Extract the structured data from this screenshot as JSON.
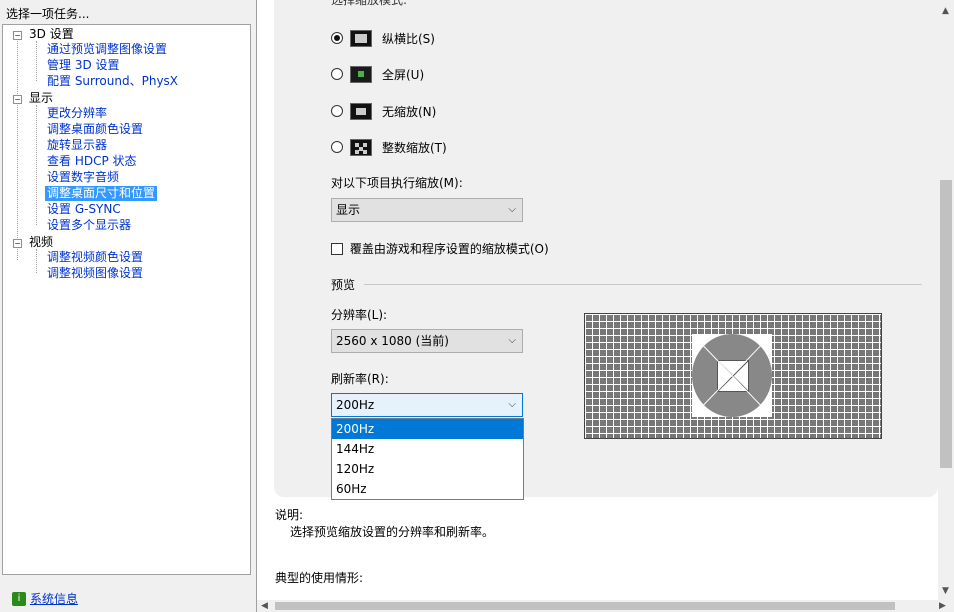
{
  "left_panel": {
    "header": "选择一项任务...",
    "tree": [
      {
        "label": "3D 设置",
        "kind": "category"
      },
      {
        "label": "通过预览调整图像设置",
        "kind": "link"
      },
      {
        "label": "管理 3D 设置",
        "kind": "link"
      },
      {
        "label": "配置 Surround、PhysX",
        "kind": "link"
      },
      {
        "label": "显示",
        "kind": "category"
      },
      {
        "label": "更改分辨率",
        "kind": "link"
      },
      {
        "label": "调整桌面颜色设置",
        "kind": "link"
      },
      {
        "label": "旋转显示器",
        "kind": "link"
      },
      {
        "label": "查看 HDCP 状态",
        "kind": "link"
      },
      {
        "label": "设置数字音频",
        "kind": "link"
      },
      {
        "label": "调整桌面尺寸和位置",
        "kind": "link",
        "selected": true
      },
      {
        "label": "设置 G-SYNC",
        "kind": "link"
      },
      {
        "label": "设置多个显示器",
        "kind": "link"
      },
      {
        "label": "视频",
        "kind": "category"
      },
      {
        "label": "调整视频颜色设置",
        "kind": "link"
      },
      {
        "label": "调整视频图像设置",
        "kind": "link"
      }
    ],
    "system_info": "系统信息"
  },
  "main": {
    "section_title_partial": "选择缩放模式:",
    "scaling_modes": [
      {
        "label": "纵横比(S)",
        "checked": true,
        "icon": "aspect-ratio-icon"
      },
      {
        "label": "全屏(U)",
        "checked": false,
        "icon": "fullscreen-icon"
      },
      {
        "label": "无缩放(N)",
        "checked": false,
        "icon": "no-scaling-icon"
      },
      {
        "label": "整数缩放(T)",
        "checked": false,
        "icon": "integer-scaling-icon"
      }
    ],
    "perform_scaling_label": "对以下项目执行缩放(M):",
    "perform_scaling_value": "显示",
    "override_checkbox_label": "覆盖由游戏和程序设置的缩放模式(O)",
    "override_checked": false,
    "preview_label": "预览",
    "resolution_label": "分辨率(L):",
    "resolution_value": "2560 x 1080 (当前)",
    "refresh_label": "刷新率(R):",
    "refresh_value": "200Hz",
    "refresh_options": [
      "200Hz",
      "144Hz",
      "120Hz",
      "60Hz"
    ],
    "refresh_selected_index": 0
  },
  "description": {
    "title": "说明:",
    "text": "选择预览缩放设置的分辨率和刷新率。",
    "typical_title": "典型的使用情形:"
  },
  "colors": {
    "selection": "#3399ff",
    "link": "#0033cc",
    "dropdown_highlight": "#0078d7"
  }
}
